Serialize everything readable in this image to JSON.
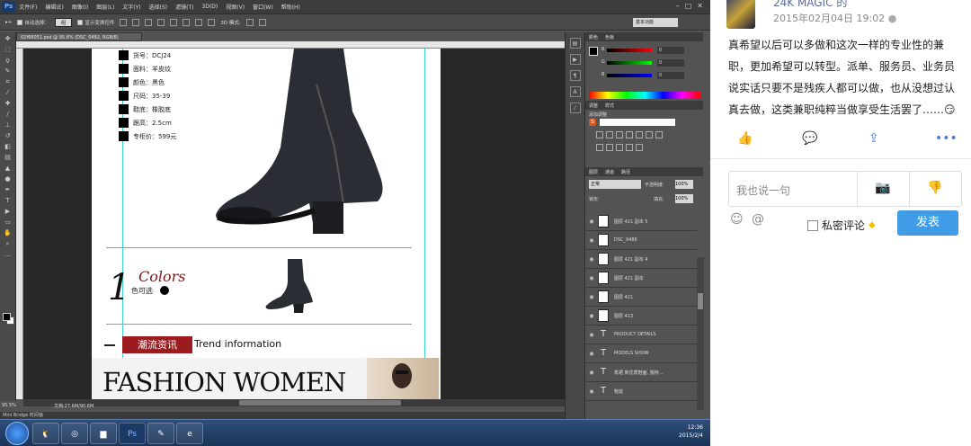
{
  "photoshop": {
    "app_logo": "Ps",
    "menu": [
      "文件(F)",
      "编辑(E)",
      "图像(I)",
      "图层(L)",
      "文字(Y)",
      "选择(S)",
      "滤镜(T)",
      "3D(D)",
      "视图(V)",
      "窗口(W)",
      "帮助(H)"
    ],
    "options": {
      "auto_select_label": "自动选择：",
      "auto_select_value": "组",
      "show_transform_label": "显示变换控件",
      "mode_3d_label": "3D 模式:"
    },
    "workspace_preset": "基本功能",
    "document_tab": "02f66051.psd @ 95.6% (DSC_0492, RGB/8)",
    "zoom": "95.5%",
    "doc_size": "文档:27.6M/90.6M",
    "mini_bridge": "Mini Bridge   时间轴",
    "canvas": {
      "specs": [
        {
          "label": "货号：DCJ24"
        },
        {
          "label": "面料：羊皮纹"
        },
        {
          "label": "颜色：黑色"
        },
        {
          "label": "尺码：35-39"
        },
        {
          "label": "鞋底：橡胶底"
        },
        {
          "label": "跟高：2.5cm"
        },
        {
          "label": "专柜价：599元"
        }
      ],
      "colors_title": "Colors",
      "colors_sub": "色可选",
      "trend_cn": "潮流资讯",
      "trend_en": "Trend information",
      "fashion_title": "FASHION WOMEN"
    },
    "panels": {
      "color_tabs": [
        "颜色",
        "色板"
      ],
      "color_channels": [
        {
          "ch": "R",
          "value": "0"
        },
        {
          "ch": "G",
          "value": "0"
        },
        {
          "ch": "B",
          "value": "0"
        }
      ],
      "adjust_tabs": [
        "调整",
        "样式"
      ],
      "adjust_title": "添加调整",
      "layer_tabs": [
        "图层",
        "通道",
        "路径"
      ],
      "blend_mode": "正常",
      "opacity_label": "不透明度:",
      "opacity_value": "100%",
      "lock_label": "锁定:",
      "fill_label": "填充:",
      "fill_value": "100%",
      "layers": [
        {
          "name": "图层 421 副本 5",
          "type": "image"
        },
        {
          "name": "DSC_9486",
          "type": "image"
        },
        {
          "name": "图层 421 副本 4",
          "type": "image"
        },
        {
          "name": "图层 421 副本",
          "type": "image"
        },
        {
          "name": "图层 421",
          "type": "image"
        },
        {
          "name": "图层 413",
          "type": "image"
        },
        {
          "name": "PRODUCT DETAILS",
          "type": "text"
        },
        {
          "name": "MODELS SHOW",
          "type": "text"
        },
        {
          "name": "蒸裙 新优质鞋面, 独特...",
          "type": "text"
        },
        {
          "name": "鞋底",
          "type": "text"
        }
      ]
    },
    "taskbar": {
      "time": "12:36",
      "date": "2015/2/4"
    }
  },
  "post": {
    "username": "24K MAGIC",
    "username_suffix": "的",
    "datetime": "2015年02月04日 19:02",
    "text": "真希望以后可以多做和这次一样的专业性的兼职，更加希望可以转型。派单、服务员、业务员说实话只要不是残疾人都可以做，也从没想过认真去做，这类兼职纯粹当做享受生活罢了……😏",
    "comment_placeholder": "我也说一句",
    "private_label": "私密评论",
    "send_label": "发表"
  },
  "colors": {
    "accent_blue": "#3f9be6",
    "brand_red": "#9b1b1f",
    "ps_dark": "#535353"
  }
}
